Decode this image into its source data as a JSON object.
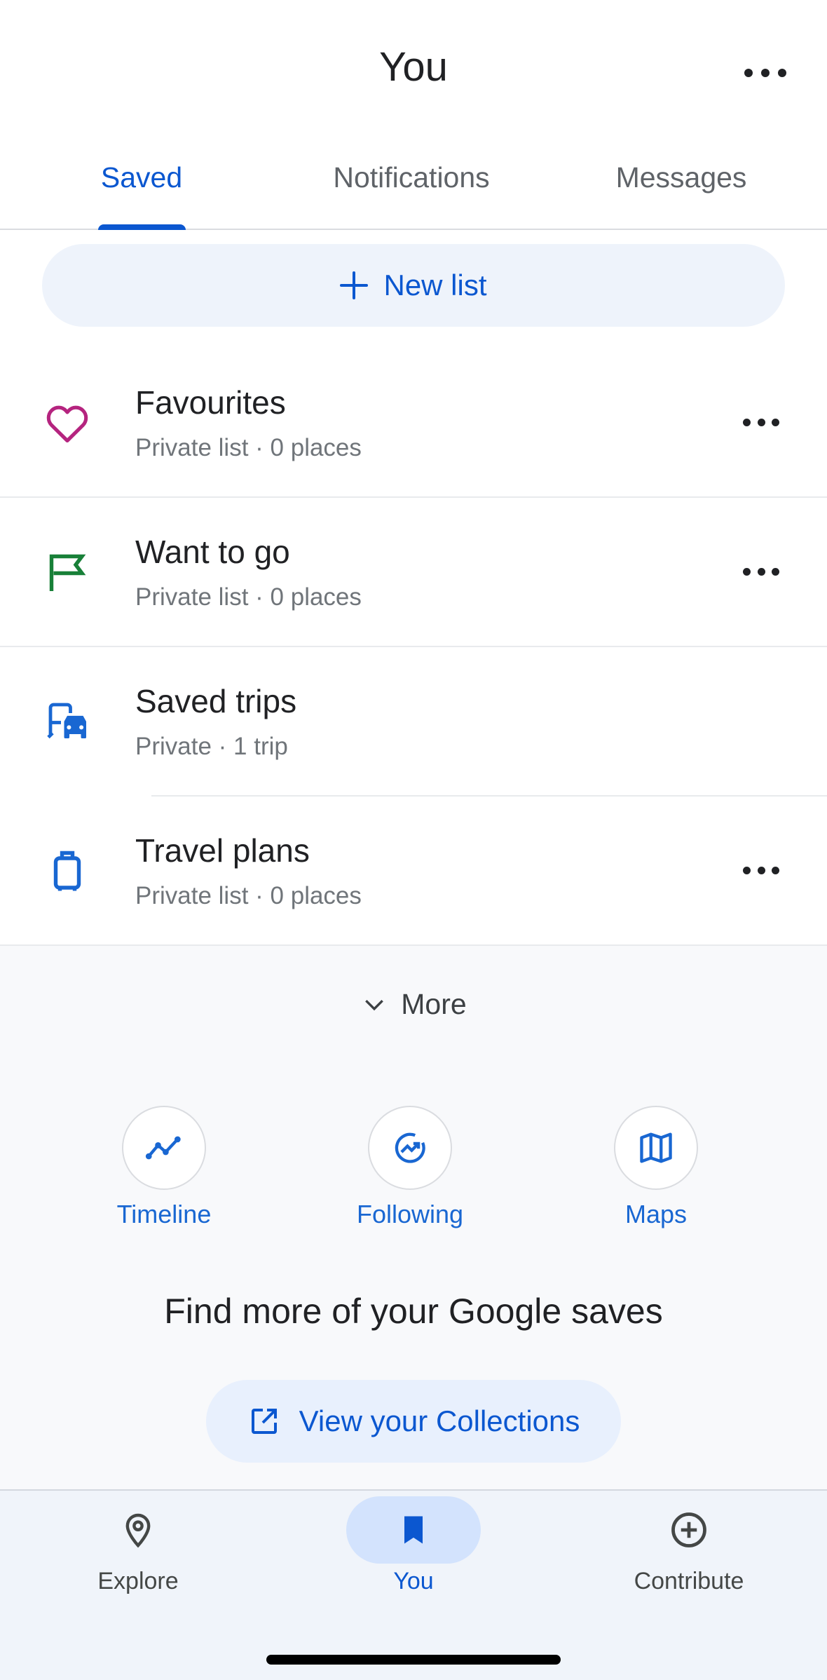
{
  "header": {
    "title": "You"
  },
  "tabs": [
    {
      "label": "Saved",
      "active": true
    },
    {
      "label": "Notifications",
      "active": false
    },
    {
      "label": "Messages",
      "active": false
    }
  ],
  "new_list": {
    "label": "New list"
  },
  "lists": [
    {
      "name": "Favourites",
      "meta": "Private list · 0 places",
      "icon": "heart-icon",
      "color": "#b5247f"
    },
    {
      "name": "Want to go",
      "meta": "Private list · 0 places",
      "icon": "flag-icon",
      "color": "#188038"
    },
    {
      "name": "Saved trips",
      "meta": "Private · 1 trip",
      "icon": "transit-car-icon",
      "color": "#1967d2"
    },
    {
      "name": "Travel plans",
      "meta": "Private list · 0 places",
      "icon": "luggage-icon",
      "color": "#1967d2"
    }
  ],
  "more_toggle": {
    "label": "More"
  },
  "shortcuts": [
    {
      "label": "Timeline",
      "icon": "timeline-icon"
    },
    {
      "label": "Following",
      "icon": "following-icon"
    },
    {
      "label": "Maps",
      "icon": "map-icon"
    }
  ],
  "collections": {
    "heading": "Find more of your Google saves",
    "button_label": "View your Collections"
  },
  "bottom_nav": [
    {
      "label": "Explore",
      "icon": "location-pin-icon",
      "active": false
    },
    {
      "label": "You",
      "icon": "bookmark-icon",
      "active": true
    },
    {
      "label": "Contribute",
      "icon": "add-circle-icon",
      "active": false
    }
  ],
  "colors": {
    "accent": "#0b57d0",
    "link": "#1967d2"
  }
}
